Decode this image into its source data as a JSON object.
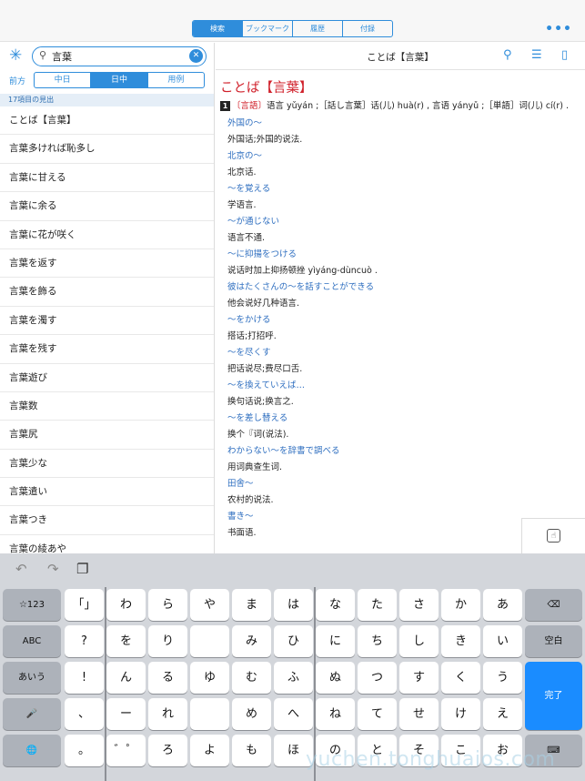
{
  "top_tabs": [
    "検索",
    "ブックマーク",
    "履歴",
    "付録"
  ],
  "more_label": "•••",
  "search": {
    "value": "言葉"
  },
  "filter": {
    "label": "前方",
    "options": [
      "中日",
      "日中",
      "用例"
    ]
  },
  "results_count": "17項目の見出",
  "results": [
    "ことば【言葉】",
    "言葉多ければ恥多し",
    "言葉に甘える",
    "言葉に余る",
    "言葉に花が咲く",
    "言葉を返す",
    "言葉を飾る",
    "言葉を濁す",
    "言葉を残す",
    "言葉遊び",
    "言葉数",
    "言葉尻",
    "言葉少な",
    "言葉遣い",
    "言葉つき",
    "言葉の綾あや"
  ],
  "detail": {
    "header_title": "ことば【言葉】",
    "headword": "ことば【言葉】",
    "sense_number": "1",
    "sense_label": "〔言語〕",
    "sense_text": "语言 yǔyán ;［話し言葉］话(儿) huà(r) , 言语 yányǔ ;［単語］词(儿) cí(r) .",
    "examples": [
      {
        "jp": "外国の～",
        "zh": "外国话;外国的说法."
      },
      {
        "jp": "北京の～",
        "zh": "北京话."
      },
      {
        "jp": "～を覚える",
        "zh": "学语言."
      },
      {
        "jp": "～が通じない",
        "zh": "语言不通."
      },
      {
        "jp": "～に抑揚をつける",
        "zh": "说话时加上抑扬顿挫 yìyáng-dùncuò ."
      },
      {
        "jp": "彼はたくさんの～を話すことができる",
        "zh": "他会说好几种语言."
      },
      {
        "jp": "～をかける",
        "zh": "搭话;打招呼."
      },
      {
        "jp": "～を尽くす",
        "zh": "把话说尽;费尽口舌."
      },
      {
        "jp": "～を換えていえば…",
        "zh": "换句话说;换言之."
      },
      {
        "jp": "～を差し替える",
        "zh": "换个『词(说法)."
      },
      {
        "jp": "わからない～を辞書で調べる",
        "zh": "用词典查生词."
      },
      {
        "jp": "田舎～",
        "zh": "农村的说法."
      },
      {
        "jp": "書き～",
        "zh": "书面语."
      }
    ]
  },
  "keyboard": {
    "left_col": [
      "☆123",
      "ABC",
      "あいう",
      "🎤",
      "🌐"
    ],
    "rows": [
      [
        "「」",
        "わ",
        "ら",
        "や",
        "ま",
        "は",
        "な",
        "た",
        "さ",
        "か",
        "あ"
      ],
      [
        "?",
        "を",
        "り",
        "",
        "み",
        "ひ",
        "に",
        "ち",
        "し",
        "き",
        "い"
      ],
      [
        "!",
        "ん",
        "る",
        "ゆ",
        "む",
        "ふ",
        "ぬ",
        "つ",
        "す",
        "く",
        "う"
      ],
      [
        "、",
        "ー",
        "れ",
        "",
        "め",
        "へ",
        "ね",
        "て",
        "せ",
        "け",
        "え"
      ],
      [
        "。",
        "゛゜",
        "ろ",
        "よ",
        "も",
        "ほ",
        "の",
        "と",
        "そ",
        "こ",
        "お"
      ]
    ],
    "backspace": "⌫",
    "space": "空白",
    "done": "完了",
    "hide": "⌨"
  },
  "watermark": "yuchen.tonghuaios.com"
}
